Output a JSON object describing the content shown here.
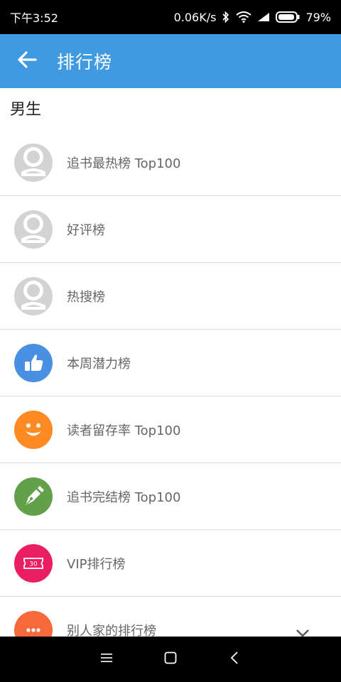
{
  "status_bar": {
    "time": "下午3:52",
    "network_speed": "0.06K/s",
    "battery": "79%"
  },
  "app_bar": {
    "title": "排行榜",
    "back_icon": "back-arrow-icon"
  },
  "section": {
    "title": "男生"
  },
  "items": [
    {
      "label": "追书最热榜 Top100",
      "icon": "default-avatar-icon",
      "color": "#d3d3d3"
    },
    {
      "label": "好评榜",
      "icon": "default-avatar-icon",
      "color": "#d3d3d3"
    },
    {
      "label": "热搜榜",
      "icon": "default-avatar-icon",
      "color": "#d3d3d3"
    },
    {
      "label": "本周潜力榜",
      "icon": "thumbs-up-icon",
      "color": "#4a90e2"
    },
    {
      "label": "读者留存率 Top100",
      "icon": "smiley-face-icon",
      "color": "#fd8a23"
    },
    {
      "label": "追书完结榜 Top100",
      "icon": "pen-nib-icon",
      "color": "#62a04a"
    },
    {
      "label": "VIP排行榜",
      "icon": "vip-ticket-icon",
      "color": "#ea1e63",
      "badge_text": "30"
    },
    {
      "label": "别人家的排行榜",
      "icon": "more-dots-icon",
      "color": "#f7693b"
    }
  ],
  "nav_bar": {
    "menu_icon": "menu-icon",
    "home_icon": "home-square-icon",
    "back_icon": "back-chevron-icon"
  }
}
